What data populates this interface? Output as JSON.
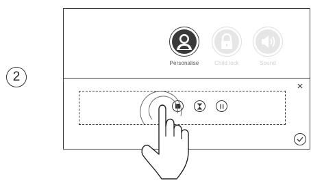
{
  "step": {
    "number": "2"
  },
  "menu": {
    "items": [
      {
        "label": "Personalise",
        "icon": "person-icon",
        "state": "active"
      },
      {
        "label": "Child lock",
        "icon": "lock-icon",
        "state": "disabled"
      },
      {
        "label": "Sound",
        "icon": "speaker-icon",
        "state": "disabled"
      }
    ]
  },
  "panel": {
    "close_icon": "close-icon",
    "confirm_icon": "checkmark-icon",
    "controls": [
      {
        "icon": "stop-icon"
      },
      {
        "icon": "hourglass-icon"
      },
      {
        "icon": "pause-icon"
      }
    ],
    "close_glyph": "×"
  },
  "colors": {
    "line": "#333333",
    "disabled": "#d0d0d0",
    "active_icon": "#3a3a3a"
  }
}
